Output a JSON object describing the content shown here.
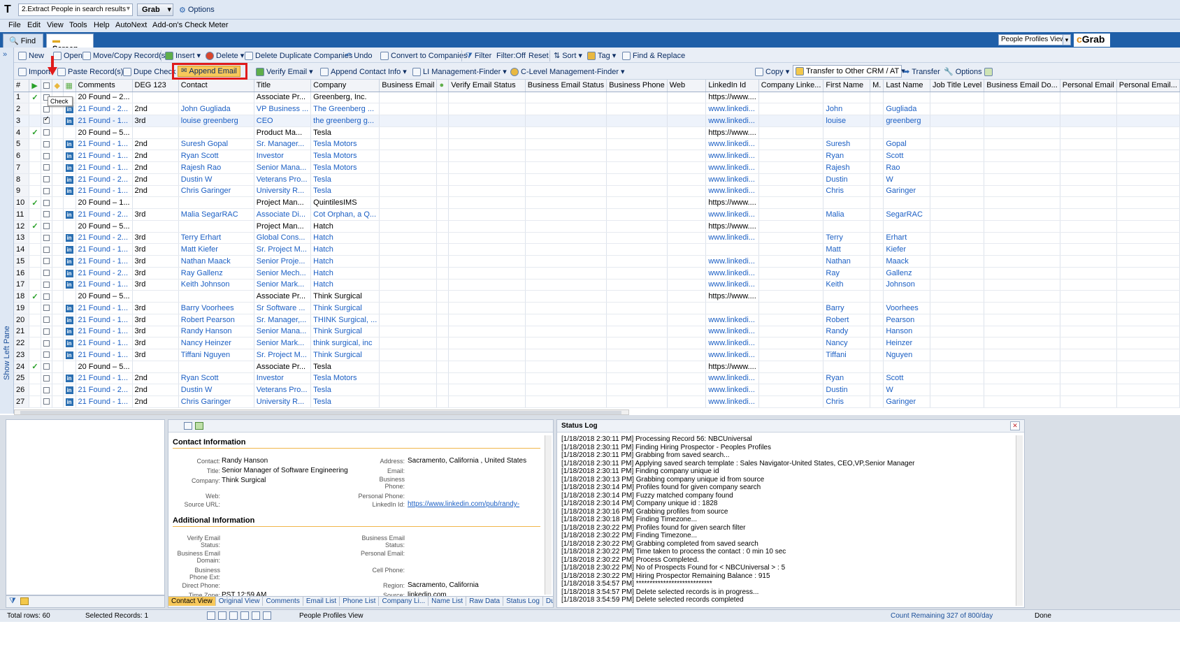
{
  "titlebar": {
    "search_name": "2.Extract People in search results",
    "grab_label": "Grab",
    "options_label": "Options"
  },
  "menu": [
    "File",
    "Edit",
    "View",
    "Tools",
    "Help",
    "AutoNext",
    "Add-on's Check Meter"
  ],
  "tabs": {
    "find": "Find",
    "screen": "Screen",
    "view_select": "People Profiles View",
    "brand": "Grab"
  },
  "left_pane_label": "Show Left Pane",
  "toolbar1": [
    {
      "label": "New",
      "icon": "new-icon"
    },
    {
      "label": "Open",
      "icon": "open-icon"
    },
    {
      "label": "Move/Copy Record(s)",
      "icon": "move-copy-icon"
    },
    {
      "label": "Insert",
      "icon": "insert-icon"
    },
    {
      "label": "Delete",
      "icon": "delete-icon"
    },
    {
      "label": "Delete Duplicate Companies",
      "icon": "duplicate-icon"
    },
    {
      "label": "Undo",
      "icon": "undo-icon"
    },
    {
      "label": "Convert to Companies",
      "icon": "convert-icon"
    },
    {
      "label": "Filter",
      "icon": "filter-icon"
    },
    {
      "label": "Filter:Off",
      "icon": ""
    },
    {
      "label": "Reset",
      "icon": ""
    },
    {
      "label": "Sort",
      "icon": "sort-icon"
    },
    {
      "label": "Tag",
      "icon": "tag-icon"
    },
    {
      "label": "Find & Replace",
      "icon": "find-replace-icon"
    }
  ],
  "toolbar2": {
    "import": "Import",
    "paste": "Paste Record(s)",
    "dupe": "Dupe Check",
    "append": "Append Email",
    "verify": "Verify Email",
    "append_contact": "Append Contact Info",
    "li_finder": "LI Management-Finder",
    "clevel": "C-Level Management-Finder",
    "copy": "Copy",
    "transfer_crm": "Transfer to Other CRM / AT",
    "transfer": "Transfer",
    "options": "Options"
  },
  "tooltip": "Check",
  "columns": [
    "#",
    "",
    "",
    "",
    "",
    "Comments",
    "DEG 123",
    "Contact",
    "Title",
    "Company",
    "Business Email",
    "",
    "Verify Email Status",
    "Business Email Status",
    "Business Phone",
    "Web",
    "LinkedIn Id",
    "Company Linke...",
    "First Name",
    "M.",
    "Last Name",
    "Job Title Level",
    "Business Email Do...",
    "Personal Email",
    "Personal Email..."
  ],
  "rows": [
    {
      "n": "1",
      "g": true,
      "c": false,
      "li": false,
      "cm": "20 Found – 2...",
      "deg": "",
      "contact": "",
      "title": "Associate Pr...",
      "company": "Greenberg, Inc.",
      "linkedin": "https://www....",
      "first": "",
      "last": ""
    },
    {
      "n": "2",
      "g": false,
      "c": false,
      "li": true,
      "cm": "21 Found - 2...",
      "deg": "2nd",
      "contact": "John Gugliada",
      "title": "VP Business ...",
      "company": "The Greenberg ...",
      "linkedin": "www.linkedi...",
      "first": "John",
      "last": "Gugliada"
    },
    {
      "n": "3",
      "g": false,
      "c": true,
      "li": true,
      "cm": "21 Found - 1...",
      "deg": "3rd",
      "contact": "louise greenberg",
      "title": "CEO",
      "company": "the greenberg g...",
      "linkedin": "www.linkedi...",
      "first": "louise",
      "last": "greenberg"
    },
    {
      "n": "4",
      "g": true,
      "c": false,
      "li": false,
      "cm": "20 Found – 5...",
      "deg": "",
      "contact": "",
      "title": "Product Ma...",
      "company": "Tesla",
      "linkedin": "https://www....",
      "first": "",
      "last": ""
    },
    {
      "n": "5",
      "g": false,
      "c": false,
      "li": true,
      "cm": "21 Found - 1...",
      "deg": "2nd",
      "contact": "Suresh Gopal",
      "title": "Sr. Manager...",
      "company": "Tesla Motors",
      "linkedin": "www.linkedi...",
      "first": "Suresh",
      "last": "Gopal"
    },
    {
      "n": "6",
      "g": false,
      "c": false,
      "li": true,
      "cm": "21 Found - 1...",
      "deg": "2nd",
      "contact": "Ryan Scott",
      "title": "Investor",
      "company": "Tesla Motors",
      "linkedin": "www.linkedi...",
      "first": "Ryan",
      "last": "Scott"
    },
    {
      "n": "7",
      "g": false,
      "c": false,
      "li": true,
      "cm": "21 Found - 1...",
      "deg": "2nd",
      "contact": "Rajesh Rao",
      "title": "Senior Mana...",
      "company": "Tesla Motors",
      "linkedin": "www.linkedi...",
      "first": "Rajesh",
      "last": "Rao"
    },
    {
      "n": "8",
      "g": false,
      "c": false,
      "li": true,
      "cm": "21 Found - 2...",
      "deg": "2nd",
      "contact": "Dustin W",
      "title": "Veterans Pro...",
      "company": "Tesla",
      "linkedin": "www.linkedi...",
      "first": "Dustin",
      "last": "W"
    },
    {
      "n": "9",
      "g": false,
      "c": false,
      "li": true,
      "cm": "21 Found - 1...",
      "deg": "2nd",
      "contact": "Chris Garinger",
      "title": "University R...",
      "company": "Tesla",
      "linkedin": "www.linkedi...",
      "first": "Chris",
      "last": "Garinger"
    },
    {
      "n": "10",
      "g": true,
      "c": false,
      "li": false,
      "cm": "20 Found – 1...",
      "deg": "",
      "contact": "",
      "title": "Project Man...",
      "company": "QuintilesIMS",
      "linkedin": "https://www....",
      "first": "",
      "last": ""
    },
    {
      "n": "11",
      "g": false,
      "c": false,
      "li": true,
      "cm": "21 Found - 2...",
      "deg": "3rd",
      "contact": "Malia SegarRAC",
      "title": "Associate Di...",
      "company": "Cot Orphan, a Q...",
      "linkedin": "www.linkedi...",
      "first": "Malia",
      "last": "SegarRAC"
    },
    {
      "n": "12",
      "g": true,
      "c": false,
      "li": false,
      "cm": "20 Found – 5...",
      "deg": "",
      "contact": "",
      "title": "Project Man...",
      "company": "Hatch",
      "linkedin": "https://www....",
      "first": "",
      "last": ""
    },
    {
      "n": "13",
      "g": false,
      "c": false,
      "li": true,
      "cm": "21 Found - 2...",
      "deg": "3rd",
      "contact": "Terry Erhart",
      "title": "Global Cons...",
      "company": "Hatch",
      "linkedin": "www.linkedi...",
      "first": "Terry",
      "last": "Erhart"
    },
    {
      "n": "14",
      "g": false,
      "c": false,
      "li": true,
      "cm": "21 Found - 1...",
      "deg": "3rd",
      "contact": "Matt Kiefer",
      "title": "Sr. Project M...",
      "company": "Hatch",
      "linkedin": "",
      "first": "Matt",
      "last": "Kiefer"
    },
    {
      "n": "15",
      "g": false,
      "c": false,
      "li": true,
      "cm": "21 Found - 1...",
      "deg": "3rd",
      "contact": "Nathan Maack",
      "title": "Senior Proje...",
      "company": "Hatch",
      "linkedin": "www.linkedi...",
      "first": "Nathan",
      "last": "Maack"
    },
    {
      "n": "16",
      "g": false,
      "c": false,
      "li": true,
      "cm": "21 Found - 2...",
      "deg": "3rd",
      "contact": "Ray Gallenz",
      "title": "Senior Mech...",
      "company": "Hatch",
      "linkedin": "www.linkedi...",
      "first": "Ray",
      "last": "Gallenz"
    },
    {
      "n": "17",
      "g": false,
      "c": false,
      "li": true,
      "cm": "21 Found - 1...",
      "deg": "3rd",
      "contact": "Keith Johnson",
      "title": "Senior Mark...",
      "company": "Hatch",
      "linkedin": "www.linkedi...",
      "first": "Keith",
      "last": "Johnson"
    },
    {
      "n": "18",
      "g": true,
      "c": false,
      "li": false,
      "cm": "20 Found – 5...",
      "deg": "",
      "contact": "",
      "title": "Associate Pr...",
      "company": "Think Surgical",
      "linkedin": "https://www....",
      "first": "",
      "last": ""
    },
    {
      "n": "19",
      "g": false,
      "c": false,
      "li": true,
      "cm": "21 Found - 1...",
      "deg": "3rd",
      "contact": "Barry Voorhees",
      "title": "Sr Software ...",
      "company": "Think Surgical",
      "linkedin": "",
      "first": "Barry",
      "last": "Voorhees"
    },
    {
      "n": "20",
      "g": false,
      "c": false,
      "li": true,
      "cm": "21 Found - 1...",
      "deg": "3rd",
      "contact": "Robert Pearson",
      "title": "Sr. Manager,...",
      "company": "THINK Surgical, ...",
      "linkedin": "www.linkedi...",
      "first": "Robert",
      "last": "Pearson"
    },
    {
      "n": "21",
      "g": false,
      "c": false,
      "li": true,
      "cm": "21 Found - 1...",
      "deg": "3rd",
      "contact": "Randy Hanson",
      "title": "Senior Mana...",
      "company": "Think Surgical",
      "linkedin": "www.linkedi...",
      "first": "Randy",
      "last": "Hanson"
    },
    {
      "n": "22",
      "g": false,
      "c": false,
      "li": true,
      "cm": "21 Found - 1...",
      "deg": "3rd",
      "contact": "Nancy Heinzer",
      "title": "Senior Mark...",
      "company": "think surgical, inc",
      "linkedin": "www.linkedi...",
      "first": "Nancy",
      "last": "Heinzer"
    },
    {
      "n": "23",
      "g": false,
      "c": false,
      "li": true,
      "cm": "21 Found - 1...",
      "deg": "3rd",
      "contact": "Tiffani Nguyen",
      "title": "Sr. Project M...",
      "company": "Think Surgical",
      "linkedin": "www.linkedi...",
      "first": "Tiffani",
      "last": "Nguyen"
    },
    {
      "n": "24",
      "g": true,
      "c": false,
      "li": false,
      "cm": "20 Found – 5...",
      "deg": "",
      "contact": "",
      "title": "Associate Pr...",
      "company": "Tesla",
      "linkedin": "https://www....",
      "first": "",
      "last": ""
    },
    {
      "n": "25",
      "g": false,
      "c": false,
      "li": true,
      "cm": "21 Found - 1...",
      "deg": "2nd",
      "contact": "Ryan Scott",
      "title": "Investor",
      "company": "Tesla Motors",
      "linkedin": "www.linkedi...",
      "first": "Ryan",
      "last": "Scott"
    },
    {
      "n": "26",
      "g": false,
      "c": false,
      "li": true,
      "cm": "21 Found - 2...",
      "deg": "2nd",
      "contact": "Dustin W",
      "title": "Veterans Pro...",
      "company": "Tesla",
      "linkedin": "www.linkedi...",
      "first": "Dustin",
      "last": "W"
    },
    {
      "n": "27",
      "g": false,
      "c": false,
      "li": true,
      "cm": "21 Found - 1...",
      "deg": "2nd",
      "contact": "Chris Garinger",
      "title": "University R...",
      "company": "Tesla",
      "linkedin": "www.linkedi...",
      "first": "Chris",
      "last": "Garinger"
    }
  ],
  "detail": {
    "contact_info_title": "Contact Information",
    "contact_label": "Contact:",
    "contact": "Randy Hanson",
    "title_label": "Title:",
    "title": "Senior Manager of Software Engineering",
    "company_label": "Company:",
    "company": "Think Surgical",
    "web_label": "Web:",
    "source_label": "Source URL:",
    "address_label": "Address:",
    "address": "Sacramento, California , United States",
    "email_label": "Email:",
    "bphone_label": "Business Phone:",
    "pphone_label": "Personal Phone:",
    "linkedin_label": "LinkedIn Id:",
    "linkedin": "https://www.linkedin.com/pub/randy-",
    "additional_title": "Additional Information",
    "ves_label": "Verify Email Status:",
    "bed_label": "Business Email Domain:",
    "bpe_label": "Business Phone Ext:",
    "dp_label": "Direct Phone:",
    "tz_label": "Time Zone:",
    "tz": "PST 12:59 AM",
    "bes_label": "Business Email Status:",
    "pe_label": "Personal Email:",
    "cp_label": "Cell Phone:",
    "region_label": "Region:",
    "region": "Sacramento, California",
    "src_label": "Source:",
    "src": "linkedin.com",
    "tabs": [
      "Contact View",
      "Original View",
      "Comments",
      "Email List",
      "Phone List",
      "Company Li...",
      "Name List",
      "Raw Data",
      "Status Log",
      "DupCheck"
    ]
  },
  "status_log": {
    "title": "Status Log",
    "lines": [
      "[1/18/2018 2:30:11 PM] Processing Record 56: NBCUniversal",
      "[1/18/2018 2:30:11 PM] Finding Hiring Prospector - Peoples Profiles",
      "[1/18/2018 2:30:11 PM] Grabbing from saved search...",
      "[1/18/2018 2:30:11 PM] Applying saved search template : Sales Navigator-United States, CEO,VP,Senior Manager",
      "[1/18/2018 2:30:11 PM] Finding company unique id",
      "[1/18/2018 2:30:13 PM] Grabbing company unique id from source",
      "[1/18/2018 2:30:14 PM] Profiles found for given company search",
      "[1/18/2018 2:30:14 PM] Fuzzy matched company found",
      "[1/18/2018 2:30:14 PM] Company unique id : 1828",
      "[1/18/2018 2:30:16 PM] Grabbing profiles from source",
      "[1/18/2018 2:30:18 PM] Finding Timezone...",
      "[1/18/2018 2:30:22 PM] Profiles found for given search filter",
      "[1/18/2018 2:30:22 PM] Finding Timezone...",
      "[1/18/2018 2:30:22 PM] Grabbing completed from saved search",
      "[1/18/2018 2:30:22 PM] Time taken to process the contact : 0 min 10 sec",
      "[1/18/2018 2:30:22 PM] Process Completed.",
      "[1/18/2018 2:30:22 PM] No of Prospects Found for < NBCUniversal > : 5",
      "[1/18/2018 2:30:22 PM] Hiring Prospector Remaining Balance : 915",
      "[1/18/2018 3:54:57 PM] ****************************",
      "[1/18/2018 3:54:57 PM] Delete selected records is in progress...",
      "[1/18/2018 3:54:59 PM] Delete selected records completed"
    ]
  },
  "statusbar": {
    "total": "Total rows: 60",
    "selected": "Selected Records: 1",
    "view": "People Profiles View",
    "count": "Count Remaining 327 of 800/day",
    "done": "Done"
  }
}
